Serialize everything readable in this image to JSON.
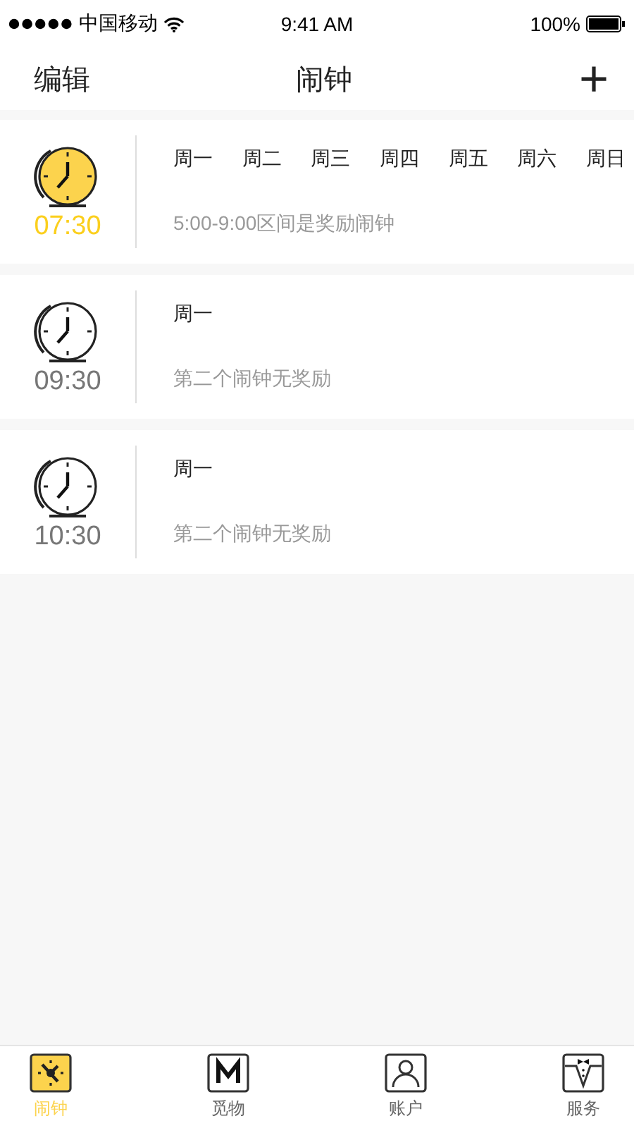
{
  "status_bar": {
    "carrier": "中国移动",
    "time": "9:41 AM",
    "battery": "100%"
  },
  "nav": {
    "left": "编辑",
    "title": "闹钟",
    "right": "+"
  },
  "alarms": [
    {
      "time": "07:30",
      "active": true,
      "days": [
        "周一",
        "周二",
        "周三",
        "周四",
        "周五",
        "周六",
        "周日"
      ],
      "note": "5:00-9:00区间是奖励闹钟"
    },
    {
      "time": "09:30",
      "active": false,
      "days": [
        "周一"
      ],
      "note": "第二个闹钟无奖励"
    },
    {
      "time": "10:30",
      "active": false,
      "days": [
        "周一"
      ],
      "note": "第二个闹钟无奖励"
    }
  ],
  "tab_bar": [
    {
      "label": "闹钟",
      "kind": "alarm",
      "selected": true
    },
    {
      "label": "觅物",
      "kind": "m",
      "selected": false
    },
    {
      "label": "账户",
      "kind": "person",
      "selected": false
    },
    {
      "label": "服务",
      "kind": "suit",
      "selected": false
    }
  ]
}
